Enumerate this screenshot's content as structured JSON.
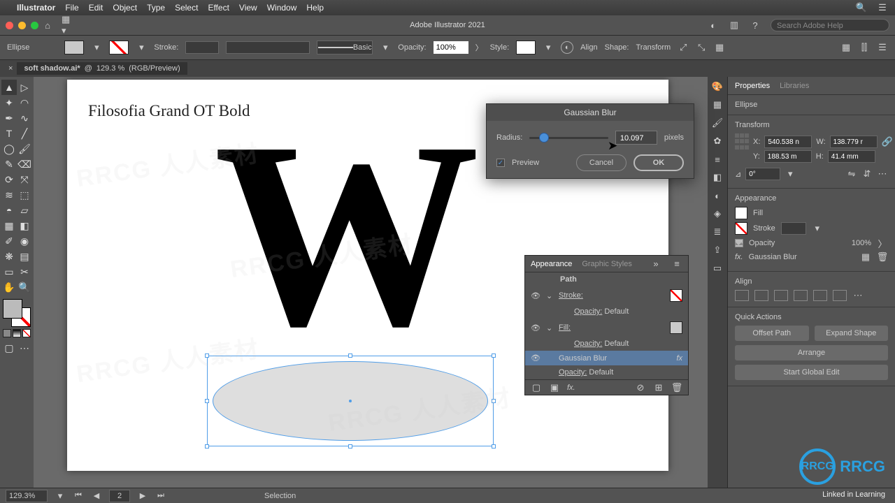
{
  "mac_menu": {
    "apple": "",
    "app": "Illustrator",
    "items": [
      "File",
      "Edit",
      "Object",
      "Type",
      "Select",
      "Effect",
      "View",
      "Window",
      "Help"
    ]
  },
  "titlebar": {
    "title": "Adobe Illustrator 2021",
    "search_placeholder": "Search Adobe Help"
  },
  "ctrlbar": {
    "tool_label": "Ellipse",
    "stroke_label": "Stroke:",
    "basic": "Basic",
    "opacity_label": "Opacity:",
    "opacity_value": "100%",
    "style_label": "Style:",
    "align": "Align",
    "shape": "Shape:",
    "transform": "Transform"
  },
  "doc_tab": {
    "name": "soft shadow.ai*",
    "zoom": "129.3 %",
    "mode": "(RGB/Preview)",
    "close": "×"
  },
  "canvas": {
    "font_title": "Filosofia Grand OT Bold",
    "big_w": "W"
  },
  "dialog": {
    "title": "Gaussian Blur",
    "radius_label": "Radius:",
    "radius_value": "10.097",
    "pixels": "pixels",
    "preview": "Preview",
    "cancel": "Cancel",
    "ok": "OK"
  },
  "appearance_panel": {
    "tabs": [
      "Appearance",
      "Graphic Styles"
    ],
    "path_label": "Path",
    "rows": [
      {
        "label": "Stroke:",
        "extra": ""
      },
      {
        "label": "Opacity:",
        "extra": "Default"
      },
      {
        "label": "Fill:",
        "extra": ""
      },
      {
        "label": "Opacity:",
        "extra": "Default"
      },
      {
        "label": "Gaussian Blur",
        "extra": "",
        "hilite": true,
        "fx": "fx"
      },
      {
        "label": "Opacity:",
        "extra": "Default"
      }
    ]
  },
  "right": {
    "tabs": [
      "Properties",
      "Libraries"
    ],
    "selection_type": "Ellipse",
    "transform": "Transform",
    "x": "540.538 n",
    "y": "188.53 m",
    "w": "138.779 r",
    "h": "41.4 mm",
    "rotate": "0°",
    "appearance": "Appearance",
    "fill": "Fill",
    "stroke": "Stroke",
    "opacity_lbl": "Opacity",
    "opacity_val": "100%",
    "gauss": "Gaussian Blur",
    "fx": "fx.",
    "align": "Align",
    "quick": "Quick Actions",
    "offset": "Offset Path",
    "expand": "Expand Shape",
    "arrange": "Arrange",
    "start_global": "Start Global Edit"
  },
  "status": {
    "zoom": "129.3%",
    "page": "2",
    "mode": "Selection"
  },
  "watermark_text": "RRCG  人人素材",
  "rrcg": "RRCG",
  "linkedin": "Linked in Learning"
}
